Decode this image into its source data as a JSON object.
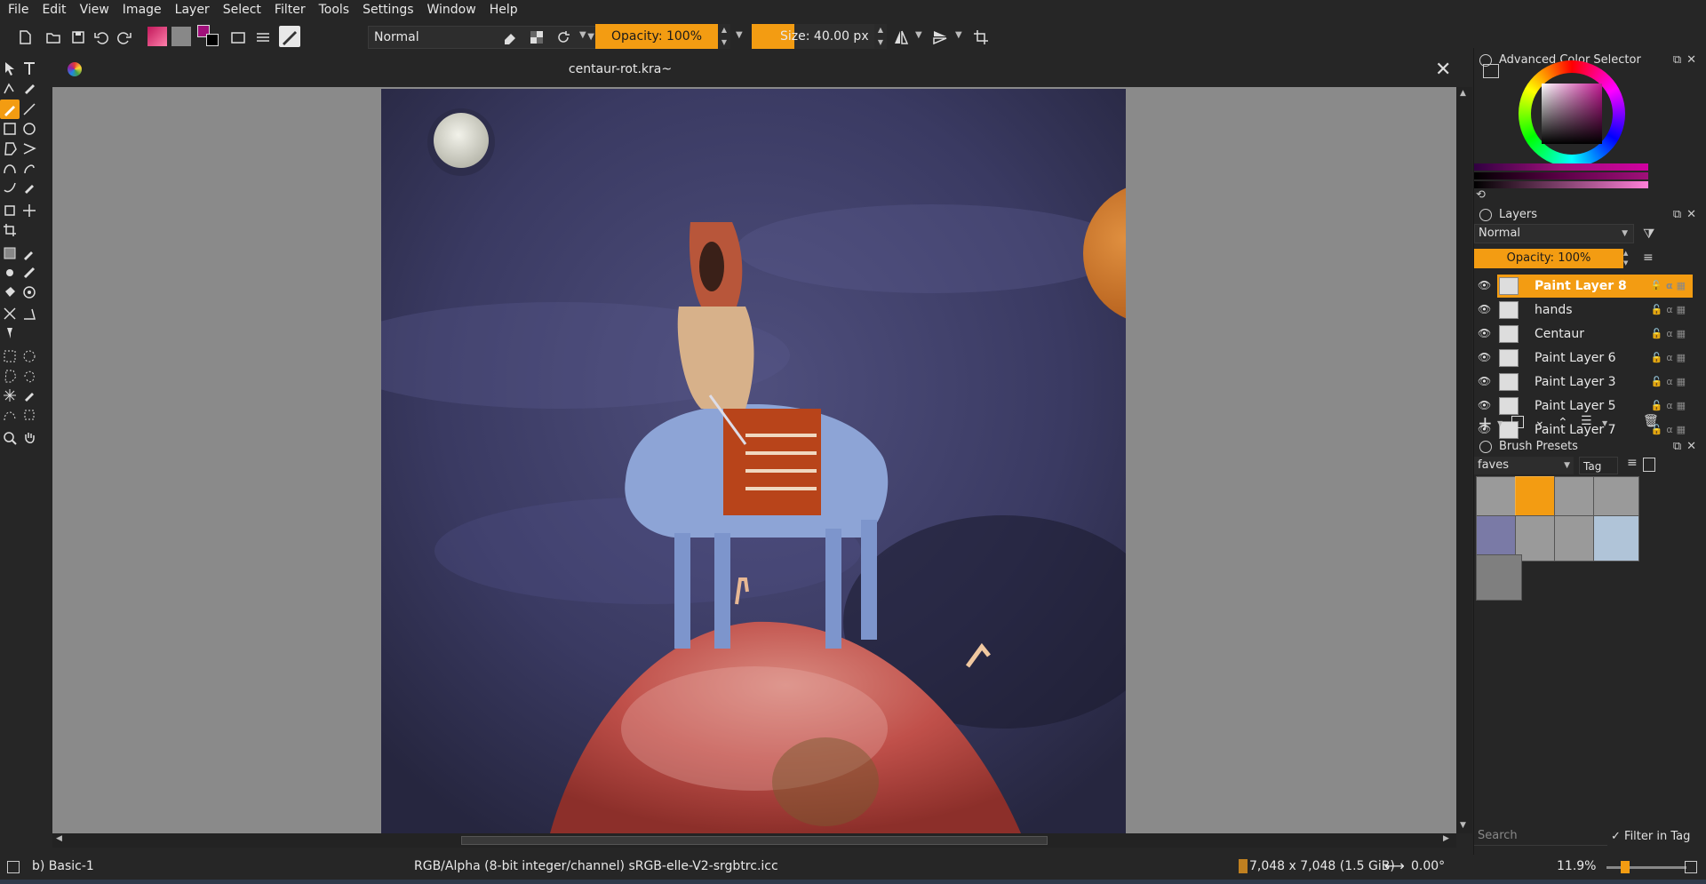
{
  "menu": [
    "File",
    "Edit",
    "View",
    "Image",
    "Layer",
    "Select",
    "Filter",
    "Tools",
    "Settings",
    "Window",
    "Help"
  ],
  "toolbar": {
    "blend_mode": "Normal",
    "opacity_label": "Opacity: 100%",
    "size_label": "Size: 40.00 px"
  },
  "document": {
    "title": "centaur-rot.kra~"
  },
  "color_selector": {
    "title": "Advanced Color Selector",
    "accent": "#f39c12"
  },
  "layers": {
    "title": "Layers",
    "blend_mode": "Normal",
    "opacity_label": "Opacity:  100%",
    "items": [
      {
        "name": "Paint Layer 8",
        "active": true
      },
      {
        "name": "hands",
        "active": false
      },
      {
        "name": "Centaur",
        "active": false
      },
      {
        "name": "Paint Layer 6",
        "active": false
      },
      {
        "name": "Paint Layer 3",
        "active": false
      },
      {
        "name": "Paint Layer 5",
        "active": false
      },
      {
        "name": "Paint Layer 7",
        "active": false
      }
    ]
  },
  "brush_presets": {
    "title": "Brush Presets",
    "tag_filter": "faves",
    "tag_button": "Tag",
    "search_placeholder": "Search",
    "filter_in_tag": "Filter in Tag"
  },
  "status": {
    "brush": "b) Basic-1",
    "color_profile": "RGB/Alpha (8-bit integer/channel)  sRGB-elle-V2-srgbtrc.icc",
    "image_size": "7,048 x 7,048 (1.5 GiB)",
    "rotation": "0.00°",
    "zoom": "11.9%"
  }
}
